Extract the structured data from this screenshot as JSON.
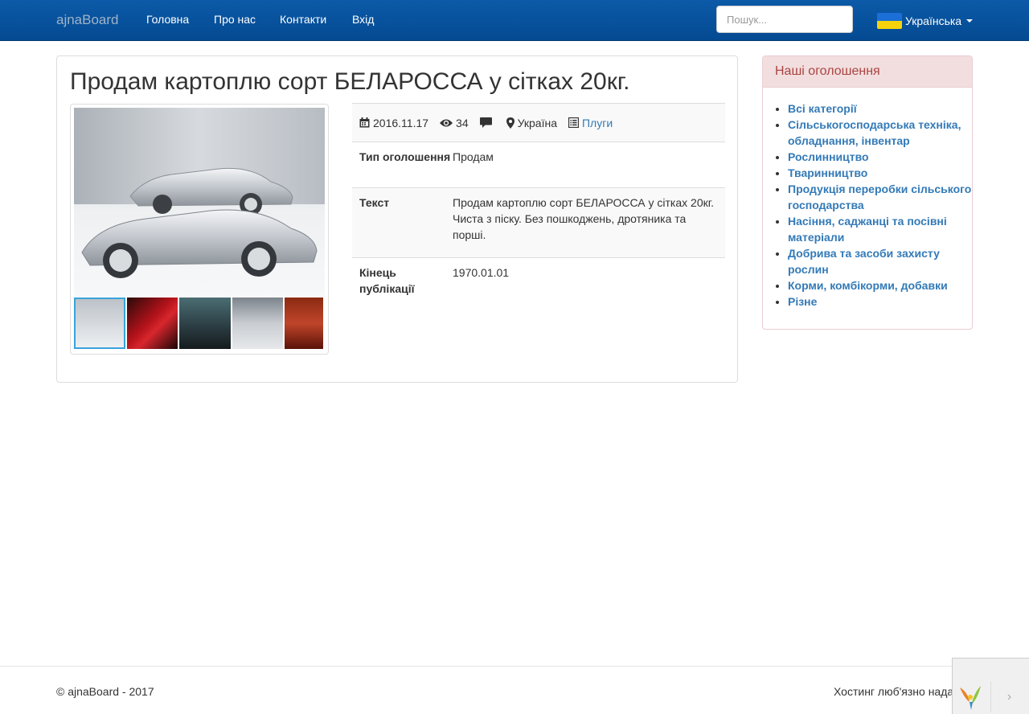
{
  "navbar": {
    "brand": "ajnaBoard",
    "links": [
      "Головна",
      "Про нас",
      "Контакти",
      "Вхід"
    ],
    "search_placeholder": "Пошук...",
    "language": "Українська"
  },
  "ad": {
    "title": "Продам картоплю сорт БЕЛАРОССА у сітках 20кг.",
    "date": "2016.11.17",
    "views": "34",
    "location": "Україна",
    "category": "Плуги",
    "fields": [
      {
        "label": "Тип оголошення",
        "value": "Продам"
      },
      {
        "label": "Текст",
        "value": "Продам картоплю сорт БЕЛАРОССА у сітках 20кг. Чиста з піску. Без пошкоджень, дротяника та порші."
      },
      {
        "label": "Кінець публікації",
        "value": "1970.01.01"
      }
    ]
  },
  "sidebar": {
    "heading": "Наші оголошення",
    "categories": [
      "Всі категорії",
      "Сільськогосподарська техніка, обладнання, інвентар",
      "Рослинництво",
      "Тваринництво",
      "Продукція переробки сільського господарства",
      "Насіння, саджанці та посівні матеріали",
      "Добрива та засоби захисту рослин",
      "Корми, комбікорми, добавки",
      "Різне"
    ]
  },
  "footer": {
    "copyright": "© ajnaBoard - 2017",
    "hosting": "Хостинг люб'язно нада"
  },
  "colors": {
    "navbar": "#044a92",
    "link": "#337ab7",
    "panel_danger_bg": "#f2dede",
    "panel_danger_text": "#a94442"
  }
}
